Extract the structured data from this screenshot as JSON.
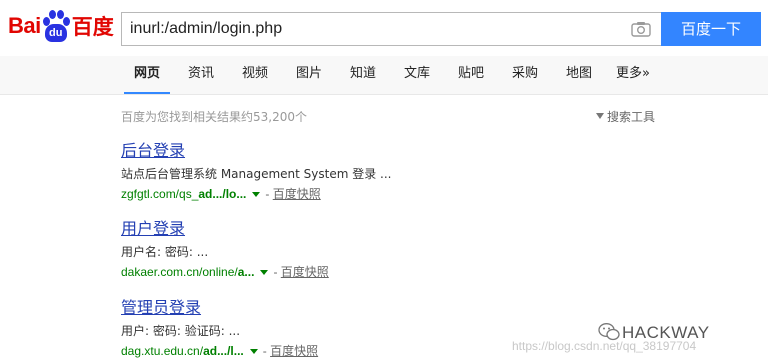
{
  "logo": {
    "left_text": "Bai",
    "paw_text": "du",
    "right_text": "百度"
  },
  "search": {
    "query": "inurl:/admin/login.php",
    "button_label": "百度一下"
  },
  "tabs": [
    {
      "label": "网页"
    },
    {
      "label": "资讯"
    },
    {
      "label": "视频"
    },
    {
      "label": "图片"
    },
    {
      "label": "知道"
    },
    {
      "label": "文库"
    },
    {
      "label": "贴吧"
    },
    {
      "label": "采购"
    },
    {
      "label": "地图"
    },
    {
      "label": "更多»"
    }
  ],
  "meta": {
    "result_count": "百度为您找到相关结果约53,200个",
    "tools_label": "搜索工具"
  },
  "results": [
    {
      "title": "后台登录",
      "abstract": "站点后台管理系统 Management System 登录 ...",
      "url_pre": "zgfgtl.com/qs_",
      "url_bold": "ad.../lo...",
      "sep": "-",
      "snapshot": "百度快照"
    },
    {
      "title": "用户登录",
      "abstract": "用户名: 密码: ...",
      "url_pre": "dakaer.com.cn/online/",
      "url_bold": "a...",
      "sep": "-",
      "snapshot": "百度快照"
    },
    {
      "title": "管理员登录",
      "abstract": "用户: 密码: 验证码: ...",
      "url_pre": "dag.xtu.edu.cn/",
      "url_bold": "ad.../l...",
      "sep": "-",
      "snapshot": "百度快照"
    }
  ],
  "watermark": {
    "brand": "HACKWAY",
    "csdn": "https://blog.csdn.net/qq_38197704"
  },
  "colors": {
    "brand_red": "#e10602",
    "brand_blue": "#2932e1",
    "button_blue": "#3385ff",
    "link_blue": "#2440b3",
    "url_green": "#008000"
  }
}
